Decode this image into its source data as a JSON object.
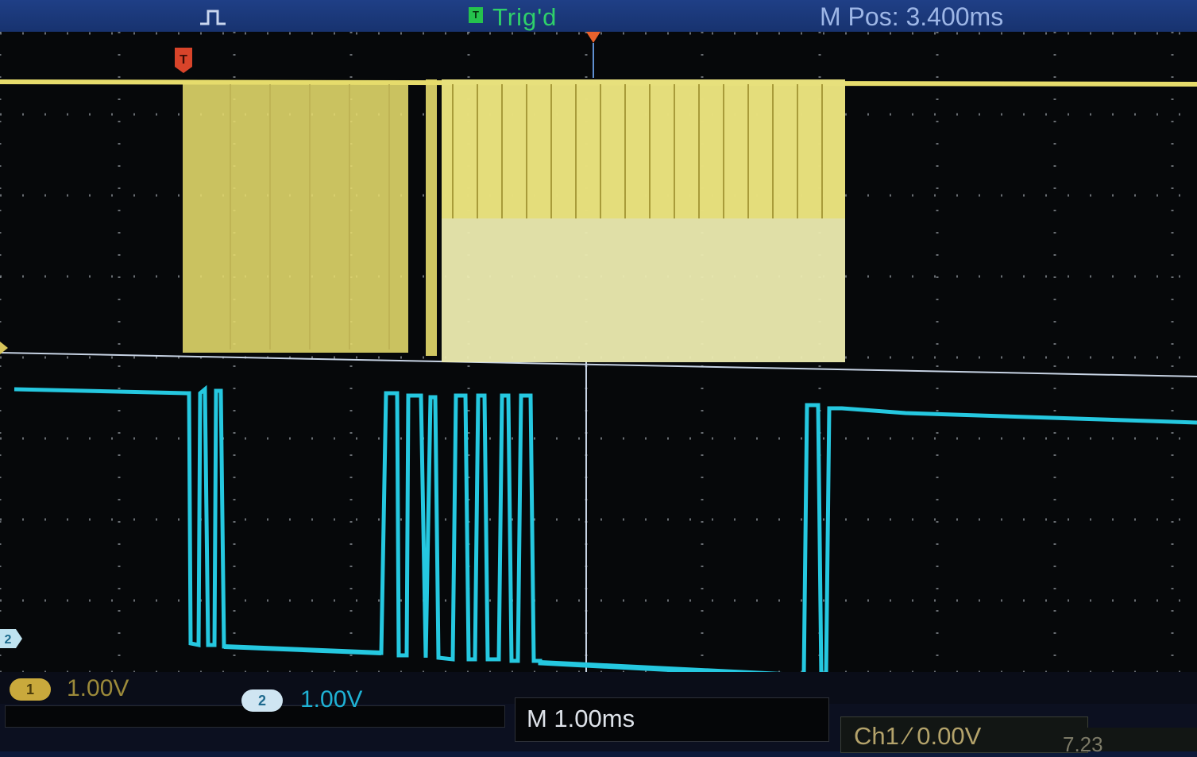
{
  "header": {
    "trigger_status": "Trig'd",
    "trigger_icon_letter": "T",
    "horizontal_position": "M Pos: 3.400ms",
    "trigger_type_icon": "pulse-icon"
  },
  "channels": [
    {
      "id": "1",
      "scale": "1.00V",
      "color": "#e6dc6c"
    },
    {
      "id": "2",
      "scale": "1.00V",
      "color": "#25c8e0"
    }
  ],
  "timebase": "M 1.00ms",
  "trigger_setting": "Ch1 ∕ 0.00V",
  "frequency_readout": "7.23",
  "screen_markers": {
    "trigger_marker_letter": "T",
    "ch2_ground_marker": "2"
  },
  "colors": {
    "ch1": "#e6dc6c",
    "ch2": "#25c8e0",
    "grid": "#8a8f96",
    "background": "#06080a",
    "bar": "#1a357a"
  }
}
